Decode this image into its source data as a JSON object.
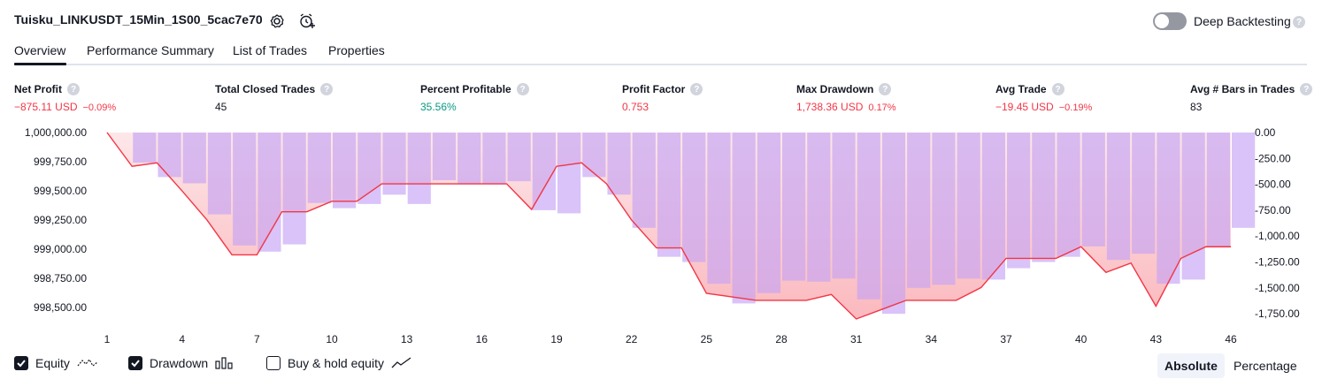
{
  "header": {
    "title": "Tuisku_LINKUSDT_15Min_1S00_5cac7e70",
    "deep_backtesting_label": "Deep Backtesting",
    "deep_backtesting_on": false,
    "help_glyph": "?"
  },
  "tabs": [
    {
      "label": "Overview",
      "active": true
    },
    {
      "label": "Performance Summary",
      "active": false
    },
    {
      "label": "List of Trades",
      "active": false
    },
    {
      "label": "Properties",
      "active": false
    }
  ],
  "metrics": [
    {
      "label": "Net Profit",
      "value": "−875.11 USD",
      "pct": "−0.09%",
      "tone": "neg"
    },
    {
      "label": "Total Closed Trades",
      "value": "45",
      "pct": "",
      "tone": "plain"
    },
    {
      "label": "Percent Profitable",
      "value": "35.56%",
      "pct": "",
      "tone": "pos"
    },
    {
      "label": "Profit Factor",
      "value": "0.753",
      "pct": "",
      "tone": "neg"
    },
    {
      "label": "Max Drawdown",
      "value": "1,738.36 USD",
      "pct": "0.17%",
      "tone": "neg"
    },
    {
      "label": "Avg Trade",
      "value": "−19.45 USD",
      "pct": "−0.19%",
      "tone": "neg"
    },
    {
      "label": "Avg # Bars in Trades",
      "value": "83",
      "pct": "",
      "tone": "plain"
    }
  ],
  "chart_data": {
    "type": "line",
    "x_ticks": [
      "1",
      "4",
      "7",
      "10",
      "13",
      "16",
      "19",
      "22",
      "25",
      "28",
      "31",
      "34",
      "37",
      "40",
      "43",
      "46"
    ],
    "left_axis_ticks": [
      "1,000,000.00",
      "999,750.00",
      "999,500.00",
      "999,250.00",
      "999,000.00",
      "998,750.00",
      "998,500.00"
    ],
    "right_axis_ticks": [
      "0.00",
      "-250.00",
      "-500.00",
      "-750.00",
      "-1,000.00",
      "-1,250.00",
      "-1,500.00",
      "-1,750.00"
    ],
    "equity_ylim": [
      998400,
      1000000
    ],
    "drawdown_ylim": [
      -1800,
      0
    ],
    "x": [
      1,
      2,
      3,
      4,
      5,
      6,
      7,
      8,
      9,
      10,
      11,
      12,
      13,
      14,
      15,
      16,
      17,
      18,
      19,
      20,
      21,
      22,
      23,
      24,
      25,
      26,
      27,
      28,
      29,
      30,
      31,
      32,
      33,
      34,
      35,
      36,
      37,
      38,
      39,
      40,
      41,
      42,
      43,
      44,
      45,
      46
    ],
    "series": [
      {
        "kind": "equity",
        "color": "#f23645",
        "values": [
          1000000,
          999710,
          999740,
          999500,
          999250,
          998950,
          998950,
          999320,
          999320,
          999410,
          999410,
          999560,
          999560,
          999560,
          999560,
          999560,
          999560,
          999340,
          999710,
          999740,
          999560,
          999250,
          999010,
          999010,
          998620,
          998590,
          998560,
          998560,
          998560,
          998610,
          998400,
          998480,
          998560,
          998560,
          998560,
          998670,
          998920,
          998920,
          998920,
          999020,
          998800,
          998880,
          998510,
          998920,
          999020,
          999020
        ]
      },
      {
        "kind": "drawdown",
        "color": "#c5a3f5",
        "values": [
          0,
          -290,
          -430,
          -490,
          -790,
          -1090,
          -1150,
          -1080,
          -680,
          -730,
          -690,
          -600,
          -690,
          -460,
          -500,
          -500,
          -470,
          -750,
          -780,
          -430,
          -600,
          -920,
          -1200,
          -1250,
          -1460,
          -1650,
          -1550,
          -1430,
          -1440,
          -1410,
          -1610,
          -1750,
          -1500,
          -1470,
          -1410,
          -1420,
          -1310,
          -1250,
          -1200,
          -1100,
          -1230,
          -1170,
          -1460,
          -1420,
          -1110,
          -920
        ]
      }
    ]
  },
  "legend": {
    "items": [
      {
        "label": "Equity",
        "checked": true,
        "icon": "equity-line-icon"
      },
      {
        "label": "Drawdown",
        "checked": true,
        "icon": "bars-icon"
      },
      {
        "label": "Buy & hold equity",
        "checked": false,
        "icon": "trend-line-icon"
      }
    ],
    "toggle": [
      {
        "label": "Absolute",
        "active": true
      },
      {
        "label": "Percentage",
        "active": false
      }
    ]
  }
}
